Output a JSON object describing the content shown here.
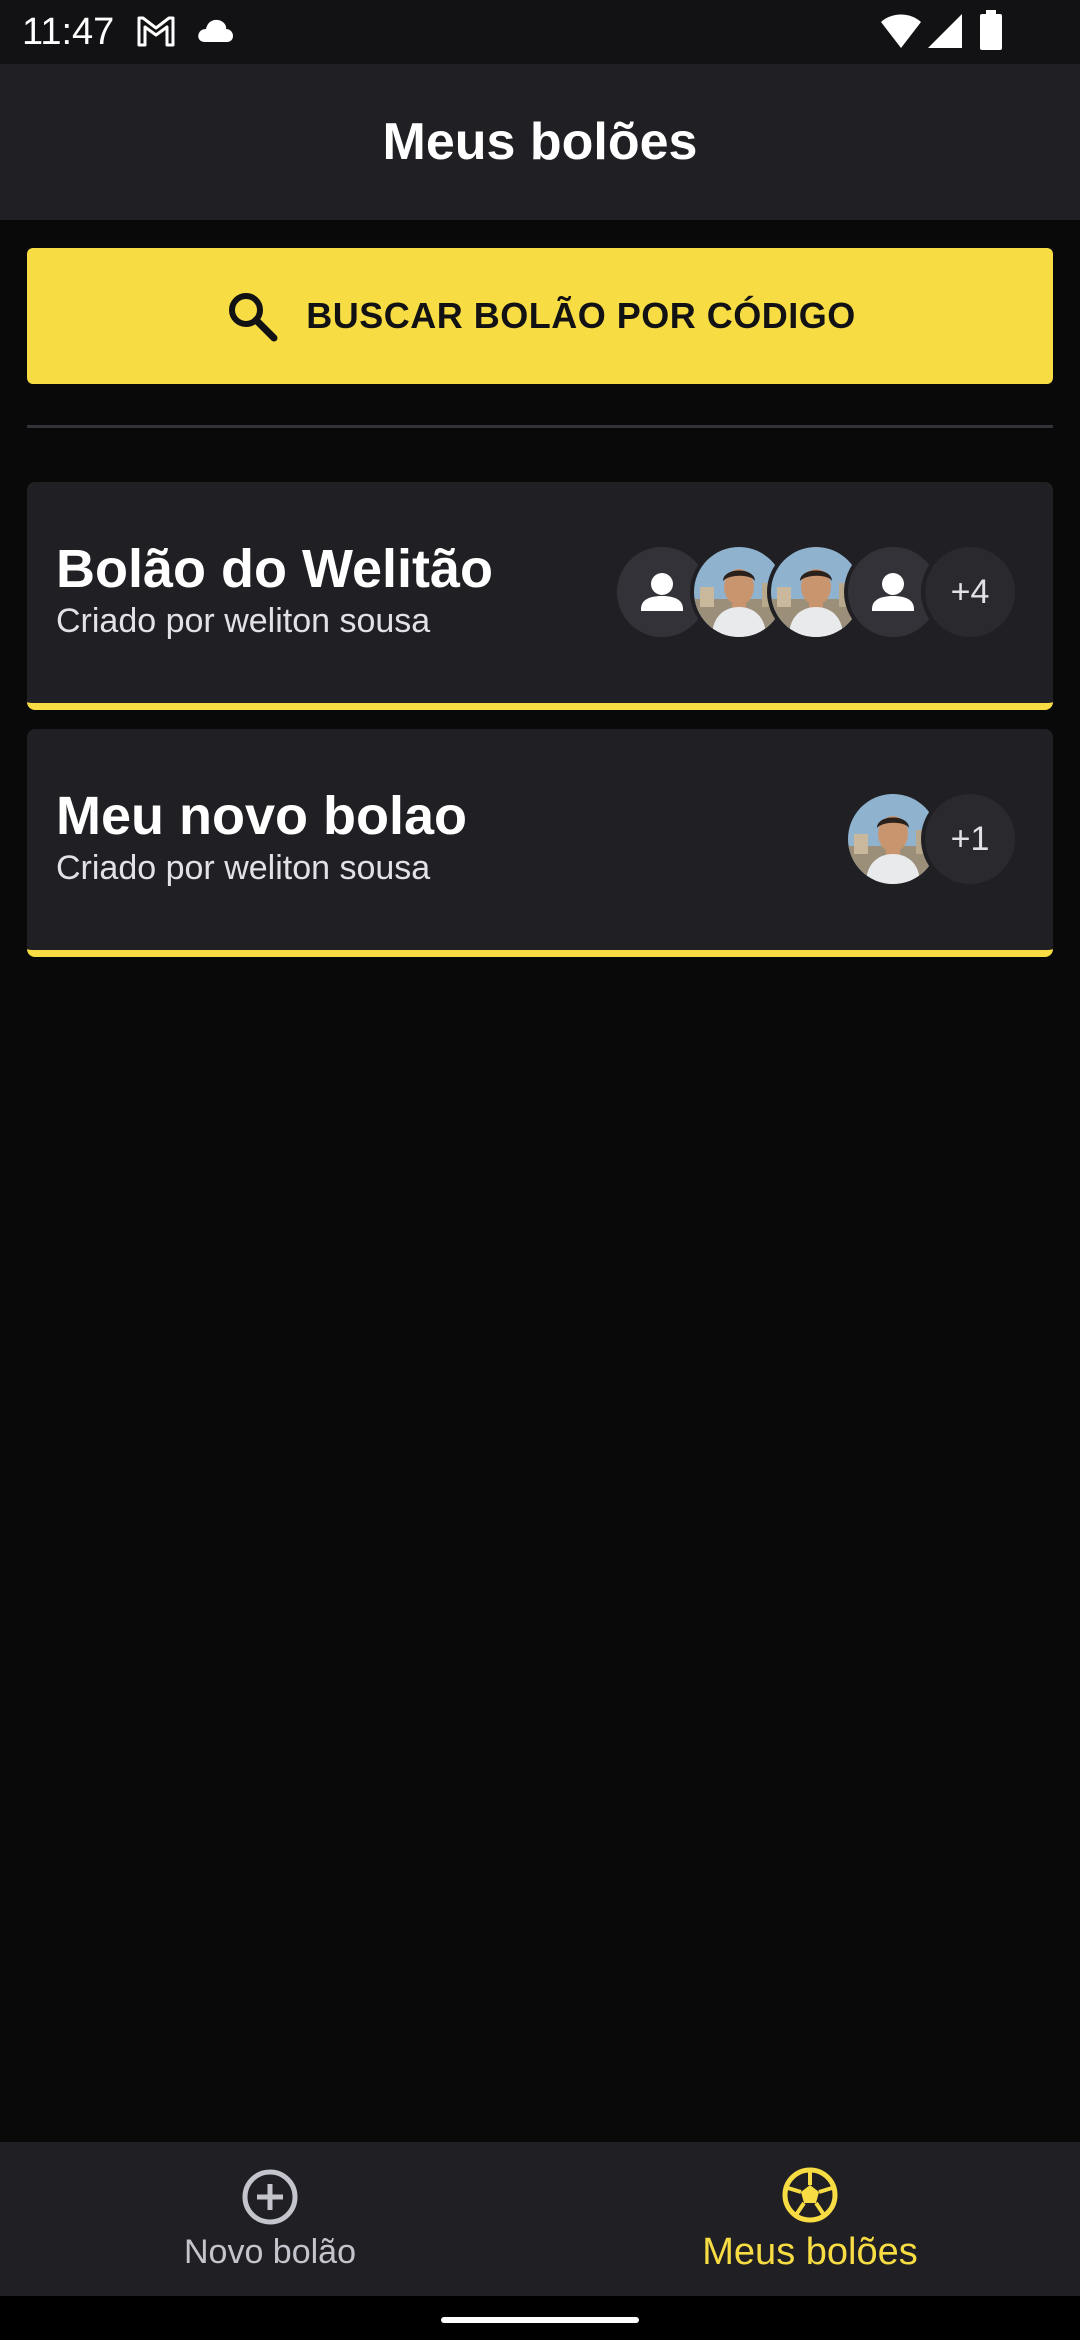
{
  "status_bar": {
    "time": "11:47",
    "icons": [
      "gmail-icon",
      "cloud-icon",
      "wifi-icon",
      "signal-icon",
      "battery-icon"
    ]
  },
  "header": {
    "title": "Meus bolões"
  },
  "search": {
    "label": "BUSCAR BOLÃO POR CÓDIGO",
    "icon": "search-icon"
  },
  "pools": [
    {
      "title": "Bolão do Welitão",
      "owner": "Criado por weliton sousa",
      "participants": [
        "user-placeholder",
        "user-photo",
        "user-photo",
        "user-placeholder"
      ],
      "extra_count": "+4"
    },
    {
      "title": "Meu novo bolao",
      "owner": "Criado por weliton sousa",
      "participants": [
        "user-photo"
      ],
      "extra_count": "+1"
    }
  ],
  "bottom_nav": {
    "items": [
      {
        "label": "Novo bolão",
        "icon": "add-circle-icon",
        "active": false
      },
      {
        "label": "Meus bolões",
        "icon": "soccer-ball-icon",
        "active": true
      }
    ]
  },
  "colors": {
    "accent": "#f7dd43",
    "background": "#09090a",
    "surface": "#202024",
    "text_secondary": "#c4c4cc"
  }
}
